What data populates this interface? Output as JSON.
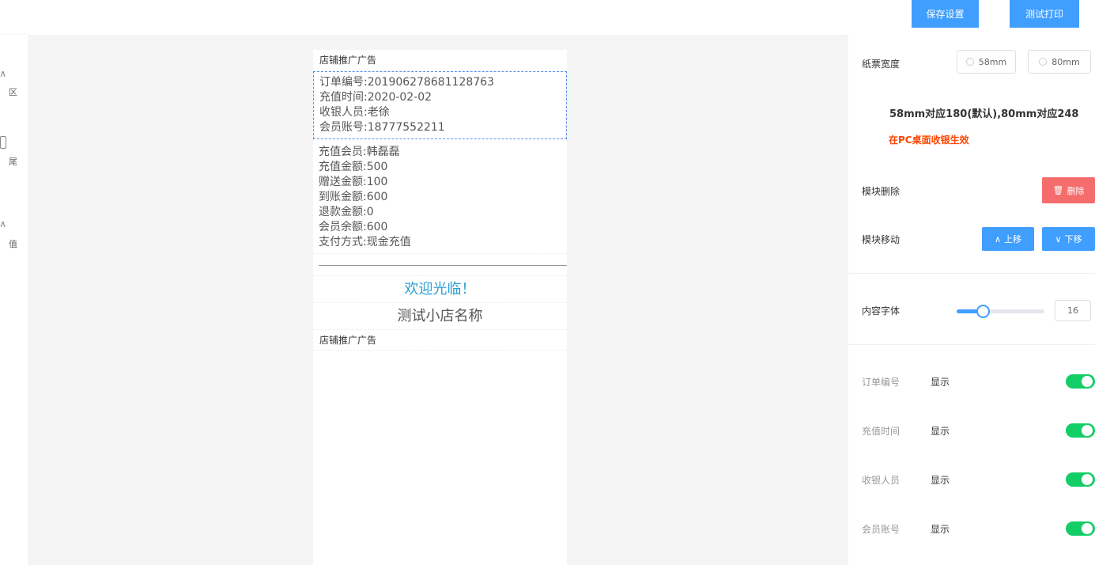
{
  "toolbar": {
    "save_label": "保存设置",
    "print_label": "测试打印"
  },
  "sidebar": {
    "items": [
      {
        "label": "区"
      },
      {
        "label": "尾"
      },
      {
        "label": "值"
      }
    ]
  },
  "receipt": {
    "ad_top": "店铺推广广告",
    "order_info": [
      "订单编号:201906278681128763",
      "充值时间:2020-02-02",
      "收银人员:老徐",
      "会员账号:18777552211"
    ],
    "recharge_info": [
      "充值会员:韩磊磊",
      "充值金额:500",
      "赠送金额:100",
      "到账金额:600",
      "退款金额:0",
      "会员余额:600",
      "支付方式:现金充值"
    ],
    "welcome": "欢迎光临！",
    "shop_name": "测试小店名称",
    "ad_bottom": "店铺推广广告"
  },
  "panel": {
    "paper_width_label": "纸票宽度",
    "paper_options": [
      "58mm",
      "80mm"
    ],
    "paper_note": "58mm对应180(默认),80mm对应248",
    "pc_note": "在PC桌面收银生效",
    "delete_label": "模块删除",
    "delete_button": "删除",
    "move_label": "模块移动",
    "move_up_button": "上移",
    "move_down_button": "下移",
    "font_label": "内容字体",
    "font_value": "16",
    "font_slider_fraction": 0.3,
    "fields": [
      {
        "name": "订单编号",
        "state": "显示",
        "on": true
      },
      {
        "name": "充值时间",
        "state": "显示",
        "on": true
      },
      {
        "name": "收银人员",
        "state": "显示",
        "on": true
      },
      {
        "name": "会员账号",
        "state": "显示",
        "on": true
      }
    ]
  }
}
